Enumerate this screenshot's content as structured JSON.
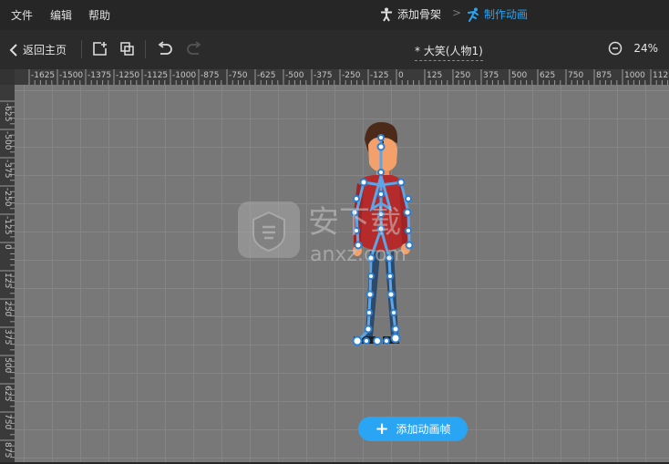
{
  "menu": {
    "file": "文件",
    "edit": "编辑",
    "help": "帮助"
  },
  "steps": {
    "add_skeleton": "添加骨架",
    "make_animation": "制作动画"
  },
  "toolbar": {
    "back_label": "返回主页",
    "doc_title": "* 大笑(人物1)",
    "zoom_value": "24%"
  },
  "ruler_top": [
    "-1625",
    "-1500",
    "-1375",
    "-1250",
    "-1125",
    "-1000",
    "-875",
    "-750",
    "-625",
    "-500",
    "-375",
    "-250",
    "-125",
    "0",
    "125",
    "250",
    "375",
    "500",
    "625",
    "750",
    "875",
    "1000",
    "1125",
    "1250"
  ],
  "ruler_left": [
    "-625",
    "-500",
    "-375",
    "-250",
    "-125",
    "0",
    "125",
    "250",
    "375",
    "500",
    "625",
    "750",
    "875"
  ],
  "watermark": {
    "text_cn": "安下载",
    "text_en": "anxz.com"
  },
  "add_frame_label": "添加动画帧",
  "colors": {
    "accent": "#2aa5f4",
    "canvas": "#787878",
    "bone": "#5aa6e8",
    "shirt": "#b52a2a"
  }
}
